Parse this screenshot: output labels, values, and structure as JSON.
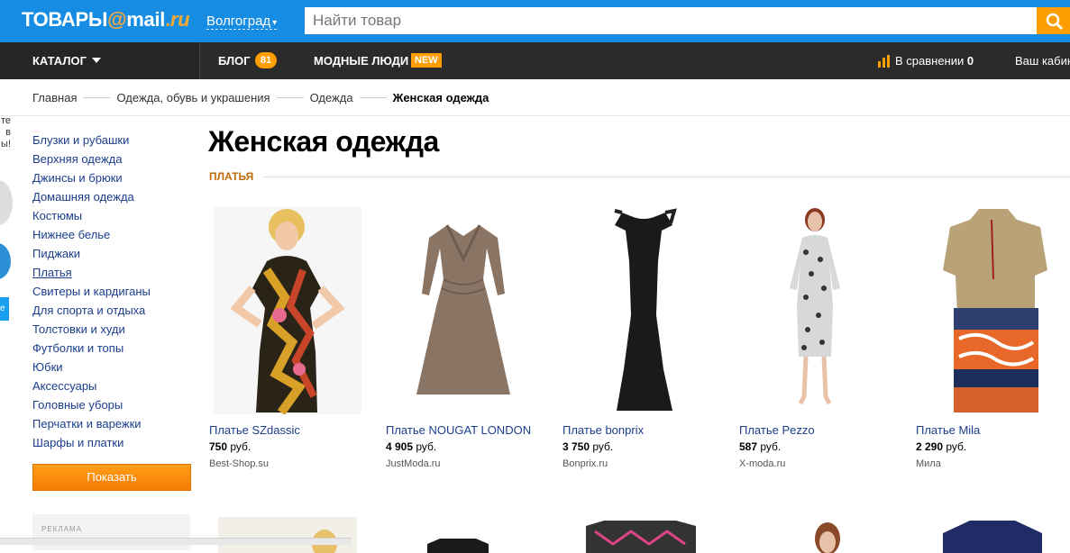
{
  "header": {
    "logo_text": "ТОВАРЫ",
    "logo_at": "@",
    "logo_mail": "mail",
    "logo_dot": ".",
    "logo_ru": "ru",
    "city": "Волгоград",
    "search_placeholder": "Найти товар"
  },
  "nav": {
    "catalog": "КАТАЛОГ",
    "blog": "БЛОГ",
    "blog_count": "81",
    "fashion": "МОДНЫЕ ЛЮДИ",
    "new_badge": "NEW",
    "compare_label": "В сравнении",
    "compare_count": "0",
    "cabinet": "Ваш кабинет"
  },
  "breadcrumbs": [
    "Главная",
    "Одежда, обувь и украшения",
    "Одежда",
    "Женская одежда"
  ],
  "left_banner": [
    "те",
    "в",
    "ы!"
  ],
  "sidebar": {
    "items": [
      "Блузки и рубашки",
      "Верхняя одежда",
      "Джинсы и брюки",
      "Домашняя одежда",
      "Костюмы",
      "Нижнее белье",
      "Пиджаки",
      "Платья",
      "Свитеры и кардиганы",
      "Для спорта и отдыха",
      "Толстовки и худи",
      "Футболки и топы",
      "Юбки",
      "Аксессуары",
      "Головные уборы",
      "Перчатки и варежки",
      "Шарфы и платки"
    ],
    "active_item": "Платья",
    "show_button": "Показать",
    "ad_label": "РЕКЛАМА"
  },
  "main": {
    "title": "Женская одежда",
    "section": "ПЛАТЬЯ"
  },
  "products": [
    {
      "name": "Платье SZdassic",
      "price": "750",
      "currency": "руб.",
      "shop": "Best-Shop.su"
    },
    {
      "name": "Платье NOUGAT LONDON",
      "price": "4 905",
      "currency": "руб.",
      "shop": "JustModa.ru"
    },
    {
      "name": "Платье bonprix",
      "price": "3 750",
      "currency": "руб.",
      "shop": "Bonprix.ru"
    },
    {
      "name": "Платье Pezzo",
      "price": "587",
      "currency": "руб.",
      "shop": "X-moda.ru"
    },
    {
      "name": "Платье Mila",
      "price": "2 290",
      "currency": "руб.",
      "shop": "Мила"
    }
  ],
  "colors": {
    "topbar": "#168de2",
    "navbar": "#2b2b2b",
    "accent": "#ff9e00",
    "link": "#1a3e8c",
    "section": "#c36a0a"
  },
  "icons": {
    "search": "search-icon",
    "compare": "bar-chart-icon",
    "catalog_caret": "triangle-down-icon",
    "city_caret": "caret-down-icon"
  }
}
